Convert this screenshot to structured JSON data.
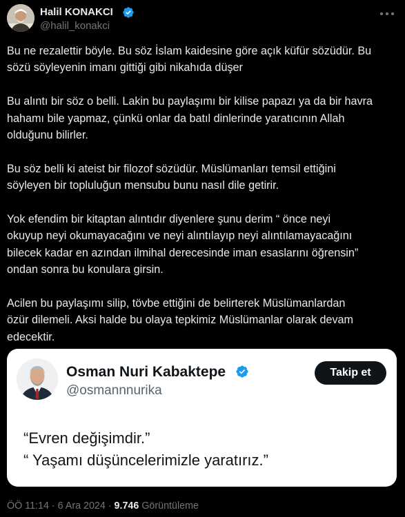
{
  "author": {
    "name": "Halil KONAKCI",
    "handle": "@halil_konakci",
    "verified": true
  },
  "tweet": {
    "paragraphs": [
      [
        "Bu ne rezalettir böyle. Bu söz İslam kaidesine göre açık küfür sözüdür. Bu",
        "sözü söyleyenin imanı gittiği gibi nikahıda düşer"
      ],
      [
        "Bu alıntı bir söz o belli. Lakin bu paylaşımı bir kilise papazı ya da bir havra",
        "hahamı bile yapmaz, çünkü onlar da batıl dinlerinde yaratıcının Allah",
        "olduğunu bilirler."
      ],
      [
        "Bu söz belli ki ateist bir filozof sözüdür. Müslümanları temsil ettiğini",
        "söyleyen bir topluluğun mensubu bunu nasıl dile getirir."
      ],
      [
        "Yok efendim bir kitaptan alıntıdır diyenlere şunu derim “ önce neyi",
        "okuyup neyi okumayacağını ve neyi alıntılayıp neyi alıntılamayacağını",
        "bilecek kadar en azından ilmihal derecesinde iman esaslarını öğrensin”",
        "ondan sonra bu konulara girsin."
      ],
      [
        "Acilen bu paylaşımı silip, tövbe ettiğini de belirterek Müslümanlardan",
        "özür dilemeli. Aksi halde bu olaya tepkimiz Müslümanlar olarak devam",
        "edecektir."
      ]
    ]
  },
  "quote_card": {
    "name": "Osman Nuri Kabaktepe",
    "handle": "@osmannnurika",
    "verified": true,
    "follow_label": "Takip et",
    "text_lines": [
      "“Evren değişimdir.”",
      "“ Yaşamı düşüncelerimizle yaratırız.”"
    ]
  },
  "meta": {
    "time": "ÖÖ 11:14",
    "separator": " · ",
    "date": "6 Ara 2024",
    "views_count": "9.746",
    "views_label": "Görüntüleme"
  },
  "colors": {
    "background": "#000000",
    "text": "#e7e9ea",
    "muted": "#71767b",
    "verified_blue": "#1d9bf0",
    "card_background": "#ffffff",
    "follow_button": "#0f1419"
  }
}
